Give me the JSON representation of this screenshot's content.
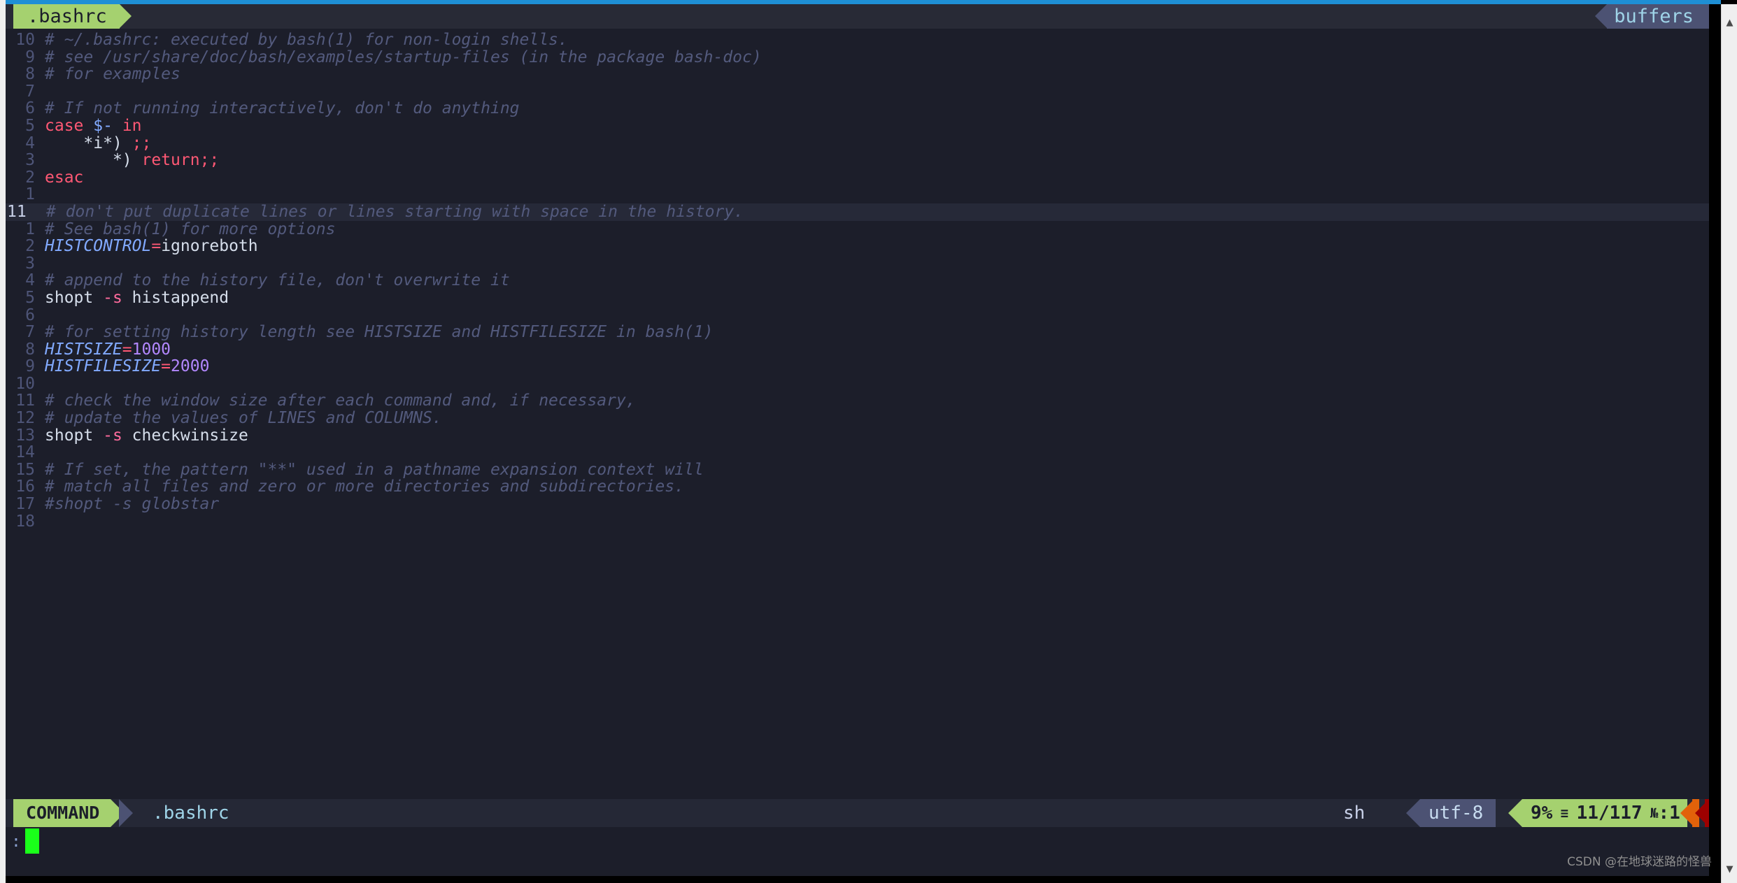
{
  "window": {
    "accent_blue": "#1e8fd5",
    "background": "#1c1e2a"
  },
  "tabline": {
    "active_tab": ".bashrc",
    "buffers_label": "buffers"
  },
  "scrollbar": {
    "up_arrow": "▲",
    "down_arrow": "▼"
  },
  "editor": {
    "filetype_syntax": "sh",
    "current_line": 11,
    "total_lines": 117,
    "lines": [
      {
        "num": "10",
        "current": false,
        "tokens": [
          {
            "t": "# ~/.bashrc: executed by bash(1) for non-login shells.",
            "c": "c-comment2"
          }
        ]
      },
      {
        "num": "9",
        "current": false,
        "tokens": [
          {
            "t": "# see /usr/share/doc/bash/examples/startup-files (in the package bash-doc)",
            "c": "c-comment2"
          }
        ]
      },
      {
        "num": "8",
        "current": false,
        "tokens": [
          {
            "t": "# for examples",
            "c": "c-comment2"
          }
        ]
      },
      {
        "num": "7",
        "current": false,
        "tokens": []
      },
      {
        "num": "6",
        "current": false,
        "tokens": [
          {
            "t": "# If not running interactively, don't do anything",
            "c": "c-comment2"
          }
        ]
      },
      {
        "num": "5",
        "current": false,
        "tokens": [
          {
            "t": "case ",
            "c": "c-kw"
          },
          {
            "t": "$-",
            "c": "c-varb"
          },
          {
            "t": " ",
            "c": "c-plain"
          },
          {
            "t": "in",
            "c": "c-kw"
          }
        ]
      },
      {
        "num": "4",
        "current": false,
        "tokens": [
          {
            "t": "    ",
            "c": "c-plain"
          },
          {
            "t": "*i*)",
            "c": "c-plain"
          },
          {
            "t": " ",
            "c": "c-plain"
          },
          {
            "t": ";;",
            "c": "c-kw"
          }
        ]
      },
      {
        "num": "3",
        "current": false,
        "tokens": [
          {
            "t": "       ",
            "c": "c-plain"
          },
          {
            "t": "*)",
            "c": "c-plain"
          },
          {
            "t": " ",
            "c": "c-plain"
          },
          {
            "t": "return;;",
            "c": "c-kw"
          }
        ]
      },
      {
        "num": "2",
        "current": false,
        "tokens": [
          {
            "t": "esac",
            "c": "c-kw"
          }
        ]
      },
      {
        "num": "1",
        "current": false,
        "tokens": []
      },
      {
        "num": "11",
        "current": true,
        "tokens": [
          {
            "t": "# don't put duplicate lines or lines starting with space in the history.",
            "c": "c-comment2"
          }
        ]
      },
      {
        "num": "1",
        "current": false,
        "tokens": [
          {
            "t": "# See bash(1) for more options",
            "c": "c-comment2"
          }
        ]
      },
      {
        "num": "2",
        "current": false,
        "tokens": [
          {
            "t": "HISTCONTROL",
            "c": "c-var"
          },
          {
            "t": "=",
            "c": "c-op"
          },
          {
            "t": "ignoreboth",
            "c": "c-plain"
          }
        ]
      },
      {
        "num": "3",
        "current": false,
        "tokens": []
      },
      {
        "num": "4",
        "current": false,
        "tokens": [
          {
            "t": "# append to the history file, don't overwrite it",
            "c": "c-comment2"
          }
        ]
      },
      {
        "num": "5",
        "current": false,
        "tokens": [
          {
            "t": "shopt ",
            "c": "c-plain"
          },
          {
            "t": "-s",
            "c": "c-flagpink"
          },
          {
            "t": " histappend",
            "c": "c-plain"
          }
        ]
      },
      {
        "num": "6",
        "current": false,
        "tokens": []
      },
      {
        "num": "7",
        "current": false,
        "tokens": [
          {
            "t": "# for setting history length see HISTSIZE and HISTFILESIZE in bash(1)",
            "c": "c-comment2"
          }
        ]
      },
      {
        "num": "8",
        "current": false,
        "tokens": [
          {
            "t": "HISTSIZE",
            "c": "c-var"
          },
          {
            "t": "=",
            "c": "c-op"
          },
          {
            "t": "1000",
            "c": "c-num"
          }
        ]
      },
      {
        "num": "9",
        "current": false,
        "tokens": [
          {
            "t": "HISTFILESIZE",
            "c": "c-var"
          },
          {
            "t": "=",
            "c": "c-op"
          },
          {
            "t": "2000",
            "c": "c-num"
          }
        ]
      },
      {
        "num": "10",
        "current": false,
        "tokens": []
      },
      {
        "num": "11",
        "current": false,
        "tokens": [
          {
            "t": "# check the window size after each command and, if necessary,",
            "c": "c-comment2"
          }
        ]
      },
      {
        "num": "12",
        "current": false,
        "tokens": [
          {
            "t": "# update the values of LINES and COLUMNS.",
            "c": "c-comment2"
          }
        ]
      },
      {
        "num": "13",
        "current": false,
        "tokens": [
          {
            "t": "shopt ",
            "c": "c-plain"
          },
          {
            "t": "-s",
            "c": "c-flagpink"
          },
          {
            "t": " checkwinsize",
            "c": "c-plain"
          }
        ]
      },
      {
        "num": "14",
        "current": false,
        "tokens": []
      },
      {
        "num": "15",
        "current": false,
        "tokens": [
          {
            "t": "# If set, the pattern \"**\" used in a pathname expansion context will",
            "c": "c-comment2"
          }
        ]
      },
      {
        "num": "16",
        "current": false,
        "tokens": [
          {
            "t": "# match all files and zero or more directories and subdirectories.",
            "c": "c-comment2"
          }
        ]
      },
      {
        "num": "17",
        "current": false,
        "tokens": [
          {
            "t": "#shopt -s globstar",
            "c": "c-comment2"
          }
        ]
      },
      {
        "num": "18",
        "current": false,
        "tokens": []
      }
    ]
  },
  "statusline": {
    "mode": "COMMAND",
    "filename": ".bashrc",
    "filetype": "sh",
    "encoding": "utf-8",
    "percent": "9%",
    "lines_symbol": "≡",
    "position": "11/117",
    "col_symbol": "№",
    "column": ":1"
  },
  "cmdline": {
    "prompt": ":",
    "value": ""
  },
  "watermark": {
    "text": "CSDN @在地球迷路的怪兽"
  }
}
